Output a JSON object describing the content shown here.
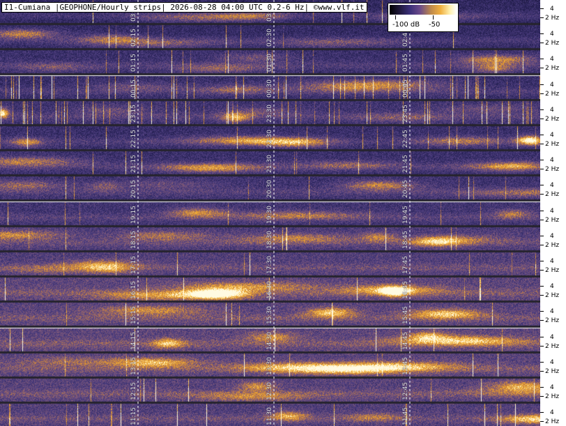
{
  "title": "I1-Cumiana |GEOPHONE/Hourly strips| 2026-08-28 04:00 UTC 0.2-6 Hz| ©www.vlf.it",
  "colorbar": {
    "min_label": "-100 dB",
    "max_label": "-50"
  },
  "freq_labels": {
    "upper": "4",
    "lower": "2 Hz"
  },
  "strips": [
    {
      "t1": "03:15",
      "t2": "03:30",
      "t3": "03:45"
    },
    {
      "t1": "02:15",
      "t2": "02:30",
      "t3": "02:45"
    },
    {
      "t1": "01:15",
      "t2": "01:30",
      "t3": "01:45"
    },
    {
      "t1": "00:15",
      "t2": "00:30",
      "t3": "00:45"
    },
    {
      "t1": "23:15",
      "t2": "23:30",
      "t3": "23:45"
    },
    {
      "t1": "22:15",
      "t2": "22:30",
      "t3": "22:45"
    },
    {
      "t1": "21:15",
      "t2": "21:30",
      "t3": "21:45"
    },
    {
      "t1": "20:15",
      "t2": "20:30",
      "t3": "20:45"
    },
    {
      "t1": "19:15",
      "t2": "19:30",
      "t3": "19:45"
    },
    {
      "t1": "18:15",
      "t2": "18:30",
      "t3": "18:45"
    },
    {
      "t1": "17:15",
      "t2": "17:30",
      "t3": "17:45"
    },
    {
      "t1": "16:15",
      "t2": "16:30",
      "t3": "16:45"
    },
    {
      "t1": "15:15",
      "t2": "15:30",
      "t3": "15:45"
    },
    {
      "t1": "14:15",
      "t2": "14:30",
      "t3": "14:45"
    },
    {
      "t1": "13:15",
      "t2": "13:30",
      "t3": "13:45"
    },
    {
      "t1": "12:15",
      "t2": "12:30",
      "t3": "12:45"
    },
    {
      "t1": "11:15",
      "t2": "11:30",
      "t3": "11:45"
    }
  ],
  "colors": {
    "background_low": "#2a2450",
    "background_mid": "#4b3f7a",
    "hot": "#f0a030",
    "hottest": "#fff6c8",
    "gridline": "#ffffff"
  }
}
